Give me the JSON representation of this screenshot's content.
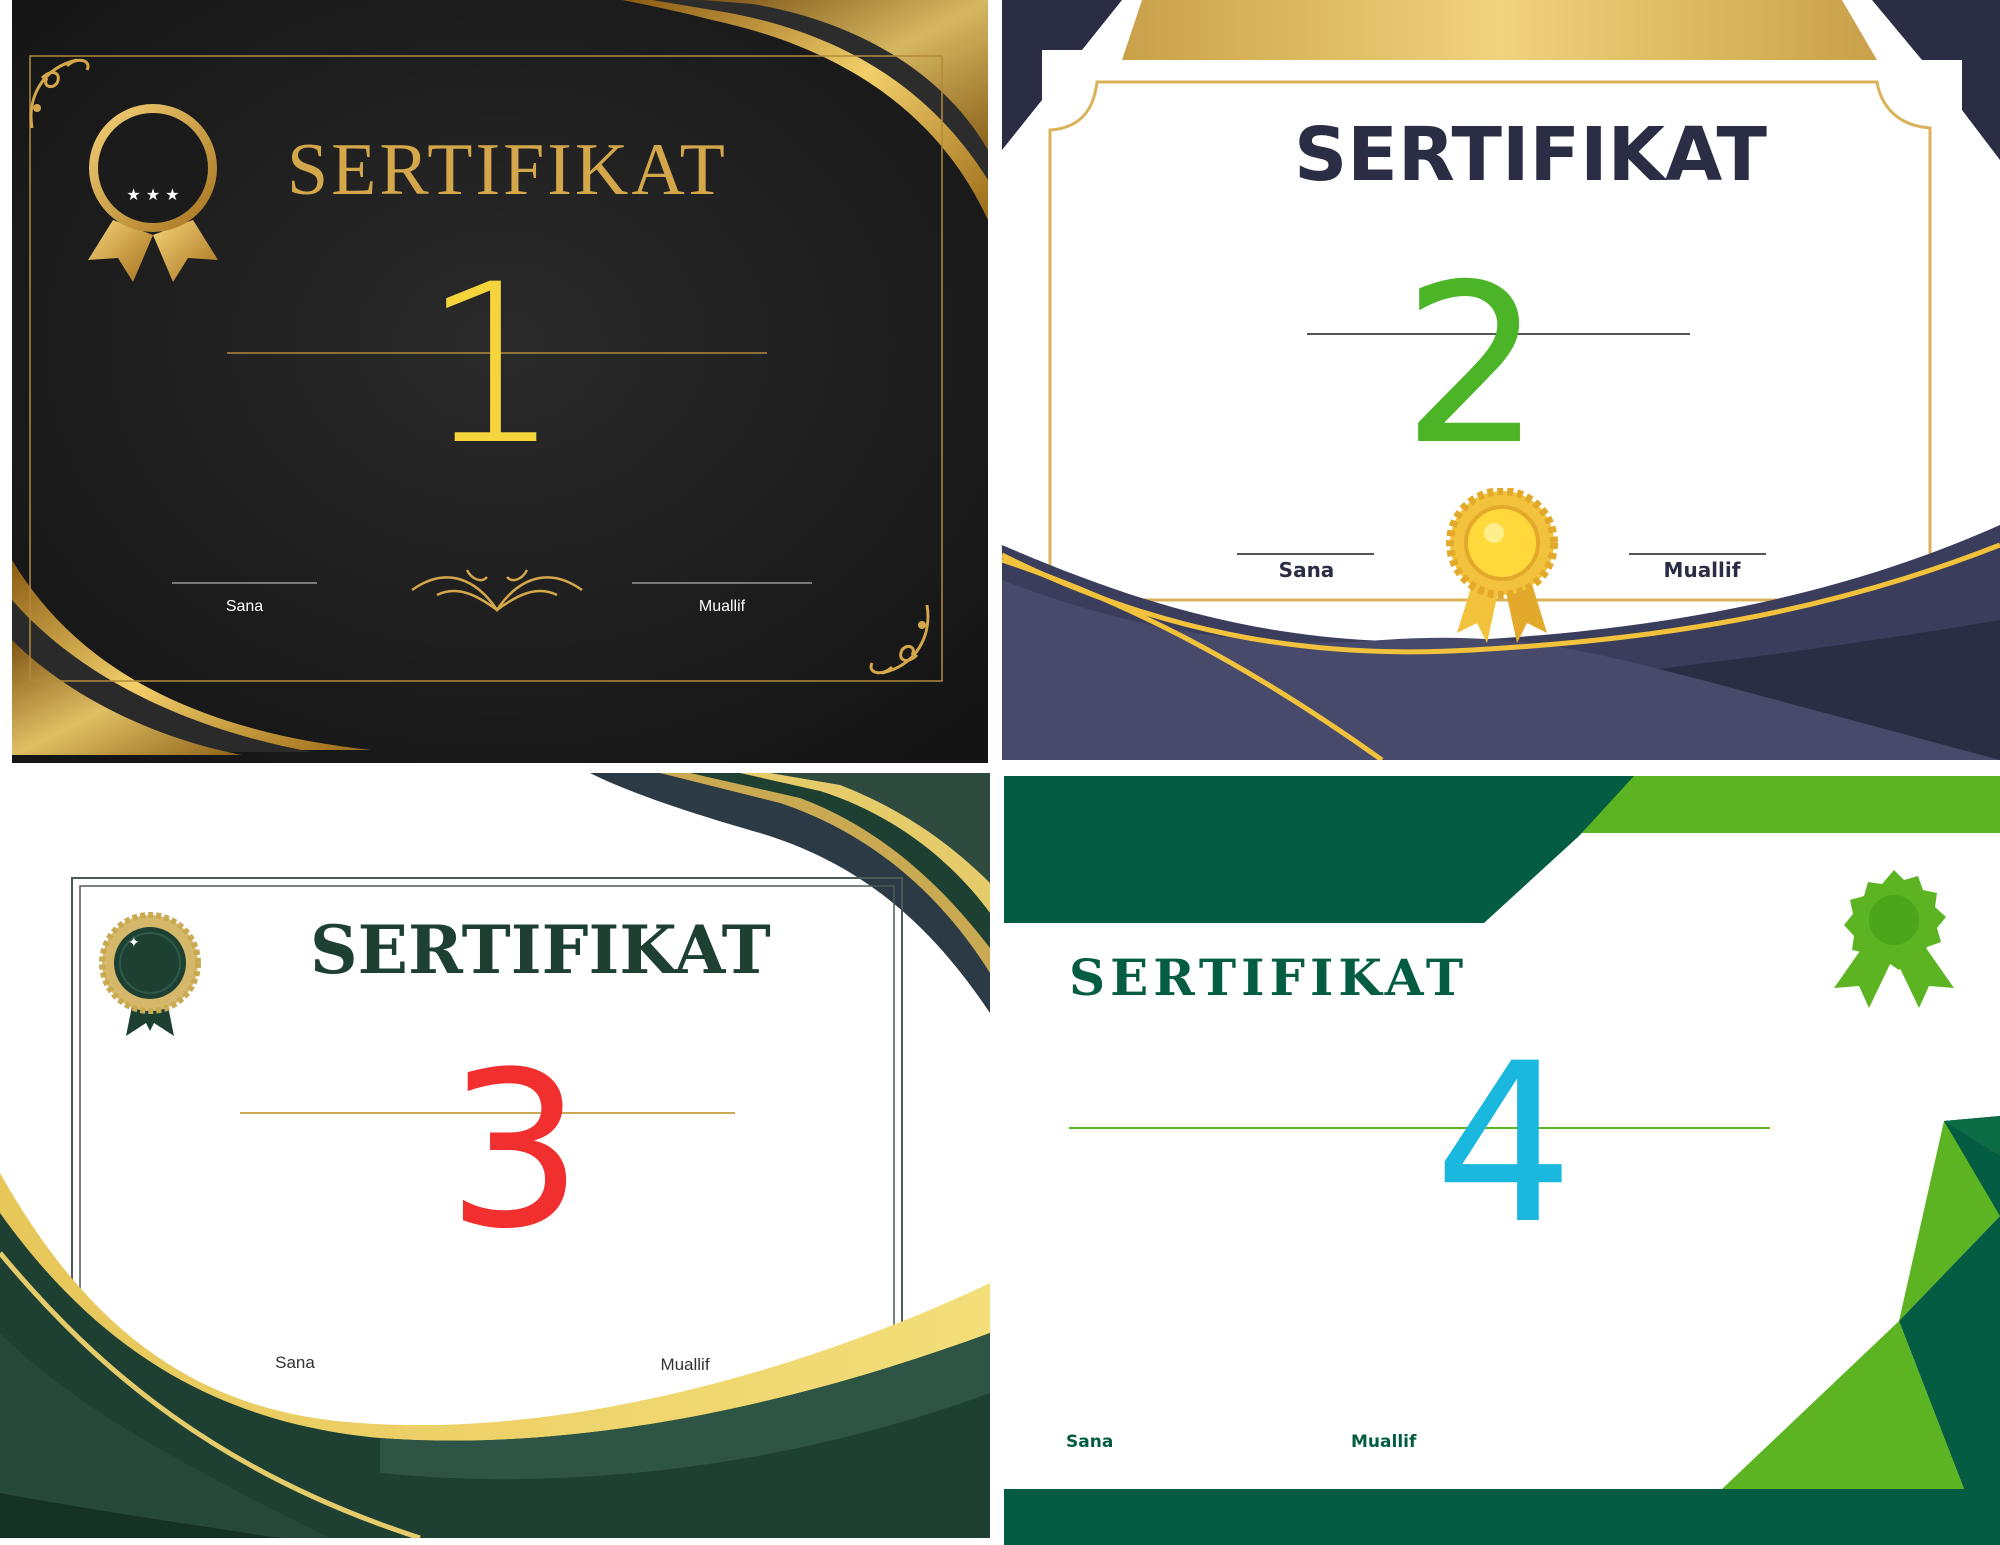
{
  "certificates": [
    {
      "title": "SERTIFIKAT",
      "number": "1",
      "date_label": "Sana",
      "author_label": "Muallif"
    },
    {
      "title": "SERTIFIKAT",
      "number": "2",
      "date_label": "Sana",
      "author_label": "Muallif"
    },
    {
      "title": "SERTIFIKAT",
      "number": "3",
      "date_label": "Sana",
      "author_label": "Muallif"
    },
    {
      "title": "SERTIFIKAT",
      "number": "4",
      "date_label": "Sana",
      "author_label": "Muallif"
    }
  ],
  "colors": {
    "card1_background": "#1e1e1e",
    "card1_gold": "#d4a74a",
    "card1_number": "#f5d43c",
    "card2_navy": "#2b2d45",
    "card2_gold": "#d9b25a",
    "card2_number": "#4cb527",
    "card3_dark_green": "#1d4033",
    "card3_gold": "#f0d86a",
    "card3_number": "#f22f2f",
    "card4_green": "#045d42",
    "card4_light_green": "#5db422",
    "card4_number": "#1ab7de"
  },
  "icons": [
    "medal-icon",
    "ornament-icon",
    "corner-flourish-icon",
    "rosette-icon",
    "seal-icon",
    "badge-icon"
  ]
}
